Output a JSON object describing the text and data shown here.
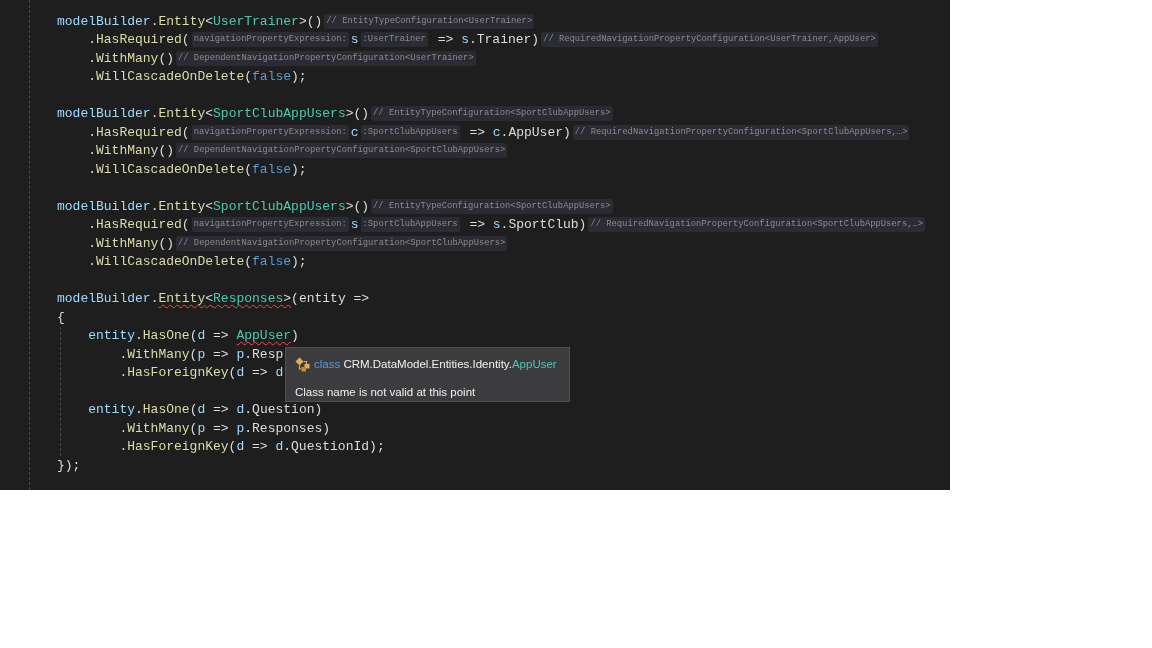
{
  "editor": {
    "lines": [
      {
        "kind": "code",
        "segments": [
          {
            "kind": "code",
            "error": false,
            "tokens": [
              {
                "text": "modelBuilder",
                "kind": "var"
              },
              {
                "text": ".",
                "kind": "plain"
              },
              {
                "text": "Entity",
                "kind": "method"
              },
              {
                "text": "<",
                "kind": "plain"
              },
              {
                "text": "UserTrainer",
                "kind": "type"
              },
              {
                "text": ">()",
                "kind": "plain"
              }
            ]
          },
          {
            "kind": "hint",
            "error": false,
            "text": "// EntityTypeConfiguration<UserTrainer>"
          }
        ],
        "children": [
          {
            "kind": "code",
            "segments": [
              {
                "kind": "code",
                "error": false,
                "tokens": [
                  {
                    "text": ".",
                    "kind": "plain"
                  },
                  {
                    "text": "HasRequired",
                    "kind": "method"
                  },
                  {
                    "text": "(",
                    "kind": "plain"
                  }
                ]
              },
              {
                "kind": "hint",
                "error": false,
                "text": "navigationPropertyExpression:"
              },
              {
                "kind": "code",
                "error": false,
                "tokens": [
                  {
                    "text": "s",
                    "kind": "var"
                  }
                ]
              },
              {
                "kind": "hint",
                "error": false,
                "text": ":UserTrainer"
              },
              {
                "kind": "code",
                "error": false,
                "tokens": [
                  {
                    "text": " => ",
                    "kind": "plain"
                  },
                  {
                    "text": "s",
                    "kind": "var"
                  },
                  {
                    "text": ".Trainer)",
                    "kind": "plain"
                  }
                ]
              },
              {
                "kind": "hint",
                "error": false,
                "text": "// RequiredNavigationPropertyConfiguration<UserTrainer,AppUser>"
              }
            ]
          },
          {
            "kind": "code",
            "segments": [
              {
                "kind": "code",
                "error": false,
                "tokens": [
                  {
                    "text": ".",
                    "kind": "plain"
                  },
                  {
                    "text": "WithMany",
                    "kind": "method"
                  },
                  {
                    "text": "()",
                    "kind": "plain"
                  }
                ]
              },
              {
                "kind": "hint",
                "error": false,
                "text": "// DependentNavigationPropertyConfiguration<UserTrainer>"
              }
            ]
          },
          {
            "kind": "code",
            "segments": [
              {
                "kind": "code",
                "error": false,
                "tokens": [
                  {
                    "text": ".",
                    "kind": "plain"
                  },
                  {
                    "text": "WillCascadeOnDelete",
                    "kind": "method"
                  },
                  {
                    "text": "(",
                    "kind": "plain"
                  },
                  {
                    "text": "false",
                    "kind": "keyword"
                  },
                  {
                    "text": ");",
                    "kind": "plain"
                  }
                ]
              }
            ]
          }
        ]
      },
      {
        "kind": "blank"
      },
      {
        "kind": "code",
        "segments": [
          {
            "kind": "code",
            "error": false,
            "tokens": [
              {
                "text": "modelBuilder",
                "kind": "var"
              },
              {
                "text": ".",
                "kind": "plain"
              },
              {
                "text": "Entity",
                "kind": "method"
              },
              {
                "text": "<",
                "kind": "plain"
              },
              {
                "text": "SportClubAppUsers",
                "kind": "type"
              },
              {
                "text": ">()",
                "kind": "plain"
              }
            ]
          },
          {
            "kind": "hint",
            "error": false,
            "text": "// EntityTypeConfiguration<SportClubAppUsers>"
          }
        ],
        "children": [
          {
            "kind": "code",
            "segments": [
              {
                "kind": "code",
                "error": false,
                "tokens": [
                  {
                    "text": ".",
                    "kind": "plain"
                  },
                  {
                    "text": "HasRequired",
                    "kind": "method"
                  },
                  {
                    "text": "(",
                    "kind": "plain"
                  }
                ]
              },
              {
                "kind": "hint",
                "error": false,
                "text": "navigationPropertyExpression:"
              },
              {
                "kind": "code",
                "error": false,
                "tokens": [
                  {
                    "text": "c",
                    "kind": "var"
                  }
                ]
              },
              {
                "kind": "hint",
                "error": false,
                "text": ":SportClubAppUsers"
              },
              {
                "kind": "code",
                "error": false,
                "tokens": [
                  {
                    "text": " => ",
                    "kind": "plain"
                  },
                  {
                    "text": "c",
                    "kind": "var"
                  },
                  {
                    "text": ".AppUser)",
                    "kind": "plain"
                  }
                ]
              },
              {
                "kind": "hint",
                "error": false,
                "text": "// RequiredNavigationPropertyConfiguration<SportClubAppUsers,…>"
              }
            ]
          },
          {
            "kind": "code",
            "segments": [
              {
                "kind": "code",
                "error": false,
                "tokens": [
                  {
                    "text": ".",
                    "kind": "plain"
                  },
                  {
                    "text": "WithMany",
                    "kind": "method"
                  },
                  {
                    "text": "()",
                    "kind": "plain"
                  }
                ]
              },
              {
                "kind": "hint",
                "error": false,
                "text": "// DependentNavigationPropertyConfiguration<SportClubAppUsers>"
              }
            ]
          },
          {
            "kind": "code",
            "segments": [
              {
                "kind": "code",
                "error": false,
                "tokens": [
                  {
                    "text": ".",
                    "kind": "plain"
                  },
                  {
                    "text": "WillCascadeOnDelete",
                    "kind": "method"
                  },
                  {
                    "text": "(",
                    "kind": "plain"
                  },
                  {
                    "text": "false",
                    "kind": "keyword"
                  },
                  {
                    "text": ");",
                    "kind": "plain"
                  }
                ]
              }
            ]
          }
        ]
      },
      {
        "kind": "blank"
      },
      {
        "kind": "code",
        "segments": [
          {
            "kind": "code",
            "error": false,
            "tokens": [
              {
                "text": "modelBuilder",
                "kind": "var"
              },
              {
                "text": ".",
                "kind": "plain"
              },
              {
                "text": "Entity",
                "kind": "method"
              },
              {
                "text": "<",
                "kind": "plain"
              },
              {
                "text": "SportClubAppUsers",
                "kind": "type"
              },
              {
                "text": ">()",
                "kind": "plain"
              }
            ]
          },
          {
            "kind": "hint",
            "error": false,
            "text": "// EntityTypeConfiguration<SportClubAppUsers>"
          }
        ],
        "children": [
          {
            "kind": "code",
            "segments": [
              {
                "kind": "code",
                "error": false,
                "tokens": [
                  {
                    "text": ".",
                    "kind": "plain"
                  },
                  {
                    "text": "HasRequired",
                    "kind": "method"
                  },
                  {
                    "text": "(",
                    "kind": "plain"
                  }
                ]
              },
              {
                "kind": "hint",
                "error": false,
                "text": "navigationPropertyExpression:"
              },
              {
                "kind": "code",
                "error": false,
                "tokens": [
                  {
                    "text": "s",
                    "kind": "var"
                  }
                ]
              },
              {
                "kind": "hint",
                "error": false,
                "text": ":SportClubAppUsers"
              },
              {
                "kind": "code",
                "error": false,
                "tokens": [
                  {
                    "text": " => ",
                    "kind": "plain"
                  },
                  {
                    "text": "s",
                    "kind": "var"
                  },
                  {
                    "text": ".SportClub)",
                    "kind": "plain"
                  }
                ]
              },
              {
                "kind": "hint",
                "error": false,
                "text": "// RequiredNavigationPropertyConfiguration<SportClubAppUsers,…>"
              }
            ]
          },
          {
            "kind": "code",
            "segments": [
              {
                "kind": "code",
                "error": false,
                "tokens": [
                  {
                    "text": ".",
                    "kind": "plain"
                  },
                  {
                    "text": "WithMany",
                    "kind": "method"
                  },
                  {
                    "text": "()",
                    "kind": "plain"
                  }
                ]
              },
              {
                "kind": "hint",
                "error": false,
                "text": "// DependentNavigationPropertyConfiguration<SportClubAppUsers>"
              }
            ]
          },
          {
            "kind": "code",
            "segments": [
              {
                "kind": "code",
                "error": false,
                "tokens": [
                  {
                    "text": ".",
                    "kind": "plain"
                  },
                  {
                    "text": "WillCascadeOnDelete",
                    "kind": "method"
                  },
                  {
                    "text": "(",
                    "kind": "plain"
                  },
                  {
                    "text": "false",
                    "kind": "keyword"
                  },
                  {
                    "text": ");",
                    "kind": "plain"
                  }
                ]
              }
            ]
          }
        ]
      },
      {
        "kind": "blank"
      },
      {
        "kind": "code",
        "segments": [
          {
            "kind": "code",
            "error": false,
            "tokens": [
              {
                "text": "modelBuilder",
                "kind": "var"
              },
              {
                "text": ".",
                "kind": "plain"
              }
            ]
          },
          {
            "kind": "code",
            "error": true,
            "tokens": [
              {
                "text": "Entity",
                "kind": "method"
              },
              {
                "text": "<",
                "kind": "plain"
              },
              {
                "text": "Responses",
                "kind": "type"
              },
              {
                "text": ">",
                "kind": "plain"
              }
            ]
          },
          {
            "kind": "code",
            "error": false,
            "tokens": [
              {
                "text": "(entity =>",
                "kind": "plain"
              }
            ]
          }
        ]
      },
      {
        "kind": "block",
        "segments": [
          {
            "kind": "code",
            "error": false,
            "tokens": [
              {
                "text": "{",
                "kind": "plain"
              }
            ]
          }
        ],
        "children": [
          {
            "kind": "code",
            "segments": [
              {
                "kind": "code",
                "error": false,
                "tokens": [
                  {
                    "text": "entity",
                    "kind": "var"
                  },
                  {
                    "text": ".",
                    "kind": "plain"
                  },
                  {
                    "text": "HasOne",
                    "kind": "method"
                  },
                  {
                    "text": "(",
                    "kind": "plain"
                  },
                  {
                    "text": "d",
                    "kind": "var"
                  },
                  {
                    "text": " => ",
                    "kind": "plain"
                  }
                ]
              },
              {
                "kind": "code",
                "error": true,
                "tokens": [
                  {
                    "text": "AppUser",
                    "kind": "type"
                  }
                ]
              },
              {
                "kind": "code",
                "error": false,
                "tokens": [
                  {
                    "text": ")",
                    "kind": "plain"
                  }
                ]
              }
            ],
            "children": [
              {
                "kind": "code",
                "segments": [
                  {
                    "kind": "code",
                    "error": false,
                    "tokens": [
                      {
                        "text": ".",
                        "kind": "plain"
                      },
                      {
                        "text": "WithMany",
                        "kind": "method"
                      },
                      {
                        "text": "(",
                        "kind": "plain"
                      },
                      {
                        "text": "p",
                        "kind": "var"
                      },
                      {
                        "text": " => ",
                        "kind": "plain"
                      },
                      {
                        "text": "p",
                        "kind": "var"
                      },
                      {
                        "text": ".Resp",
                        "kind": "plain"
                      }
                    ]
                  }
                ]
              },
              {
                "kind": "code",
                "segments": [
                  {
                    "kind": "code",
                    "error": false,
                    "tokens": [
                      {
                        "text": ".",
                        "kind": "plain"
                      },
                      {
                        "text": "HasForeignKey",
                        "kind": "method"
                      },
                      {
                        "text": "(",
                        "kind": "plain"
                      },
                      {
                        "text": "d",
                        "kind": "var"
                      },
                      {
                        "text": " => ",
                        "kind": "plain"
                      },
                      {
                        "text": "d",
                        "kind": "var"
                      }
                    ]
                  }
                ]
              }
            ]
          },
          {
            "kind": "blank"
          },
          {
            "kind": "code",
            "segments": [
              {
                "kind": "code",
                "error": false,
                "tokens": [
                  {
                    "text": "entity",
                    "kind": "var"
                  },
                  {
                    "text": ".",
                    "kind": "plain"
                  },
                  {
                    "text": "HasOne",
                    "kind": "method"
                  },
                  {
                    "text": "(",
                    "kind": "plain"
                  },
                  {
                    "text": "d",
                    "kind": "var"
                  },
                  {
                    "text": " => ",
                    "kind": "plain"
                  },
                  {
                    "text": "d",
                    "kind": "var"
                  },
                  {
                    "text": ".Question)",
                    "kind": "plain"
                  }
                ]
              }
            ],
            "children": [
              {
                "kind": "code",
                "segments": [
                  {
                    "kind": "code",
                    "error": false,
                    "tokens": [
                      {
                        "text": ".",
                        "kind": "plain"
                      },
                      {
                        "text": "WithMany",
                        "kind": "method"
                      },
                      {
                        "text": "(",
                        "kind": "plain"
                      },
                      {
                        "text": "p",
                        "kind": "var"
                      },
                      {
                        "text": " => ",
                        "kind": "plain"
                      },
                      {
                        "text": "p",
                        "kind": "var"
                      },
                      {
                        "text": ".Responses)",
                        "kind": "plain"
                      }
                    ]
                  }
                ]
              },
              {
                "kind": "code",
                "segments": [
                  {
                    "kind": "code",
                    "error": false,
                    "tokens": [
                      {
                        "text": ".",
                        "kind": "plain"
                      },
                      {
                        "text": "HasForeignKey",
                        "kind": "method"
                      },
                      {
                        "text": "(",
                        "kind": "plain"
                      },
                      {
                        "text": "d",
                        "kind": "var"
                      },
                      {
                        "text": " => ",
                        "kind": "plain"
                      },
                      {
                        "text": "d",
                        "kind": "var"
                      },
                      {
                        "text": ".QuestionId);",
                        "kind": "plain"
                      }
                    ]
                  }
                ]
              }
            ]
          }
        ]
      },
      {
        "kind": "code",
        "segments": [
          {
            "kind": "code",
            "error": false,
            "tokens": [
              {
                "text": "});",
                "kind": "plain"
              }
            ]
          }
        ]
      }
    ]
  },
  "tooltip": {
    "signature": [
      {
        "text": "class ",
        "kind": "keyword"
      },
      {
        "text": "CRM.DataModel.Entities.Identity.",
        "kind": "plain"
      },
      {
        "text": "AppUser",
        "kind": "type"
      }
    ],
    "message": "Class name is not valid at this point"
  }
}
